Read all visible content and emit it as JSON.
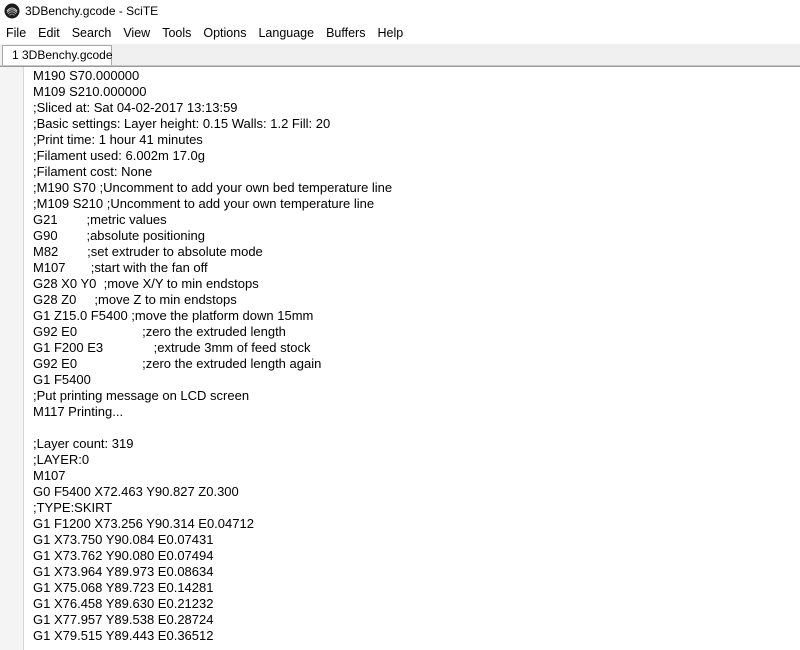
{
  "window": {
    "title": "3DBenchy.gcode - SciTE",
    "icon": "scite-app-icon"
  },
  "menu": {
    "items": [
      "File",
      "Edit",
      "Search",
      "View",
      "Tools",
      "Options",
      "Language",
      "Buffers",
      "Help"
    ]
  },
  "tabs": [
    {
      "label": "1 3DBenchy.gcode",
      "active": true
    }
  ],
  "editor": {
    "lines": [
      "M190 S70.000000",
      "M109 S210.000000",
      ";Sliced at: Sat 04-02-2017 13:13:59",
      ";Basic settings: Layer height: 0.15 Walls: 1.2 Fill: 20",
      ";Print time: 1 hour 41 minutes",
      ";Filament used: 6.002m 17.0g",
      ";Filament cost: None",
      ";M190 S70 ;Uncomment to add your own bed temperature line",
      ";M109 S210 ;Uncomment to add your own temperature line",
      "G21        ;metric values",
      "G90        ;absolute positioning",
      "M82        ;set extruder to absolute mode",
      "M107       ;start with the fan off",
      "G28 X0 Y0  ;move X/Y to min endstops",
      "G28 Z0     ;move Z to min endstops",
      "G1 Z15.0 F5400 ;move the platform down 15mm",
      "G92 E0                  ;zero the extruded length",
      "G1 F200 E3              ;extrude 3mm of feed stock",
      "G92 E0                  ;zero the extruded length again",
      "G1 F5400",
      ";Put printing message on LCD screen",
      "M117 Printing...",
      "",
      ";Layer count: 319",
      ";LAYER:0",
      "M107",
      "G0 F5400 X72.463 Y90.827 Z0.300",
      ";TYPE:SKIRT",
      "G1 F1200 X73.256 Y90.314 E0.04712",
      "G1 X73.750 Y90.084 E0.07431",
      "G1 X73.762 Y90.080 E0.07494",
      "G1 X73.964 Y89.973 E0.08634",
      "G1 X75.068 Y89.723 E0.14281",
      "G1 X76.458 Y89.630 E0.21232",
      "G1 X77.957 Y89.538 E0.28724",
      "G1 X79.515 Y89.443 E0.36512"
    ]
  }
}
